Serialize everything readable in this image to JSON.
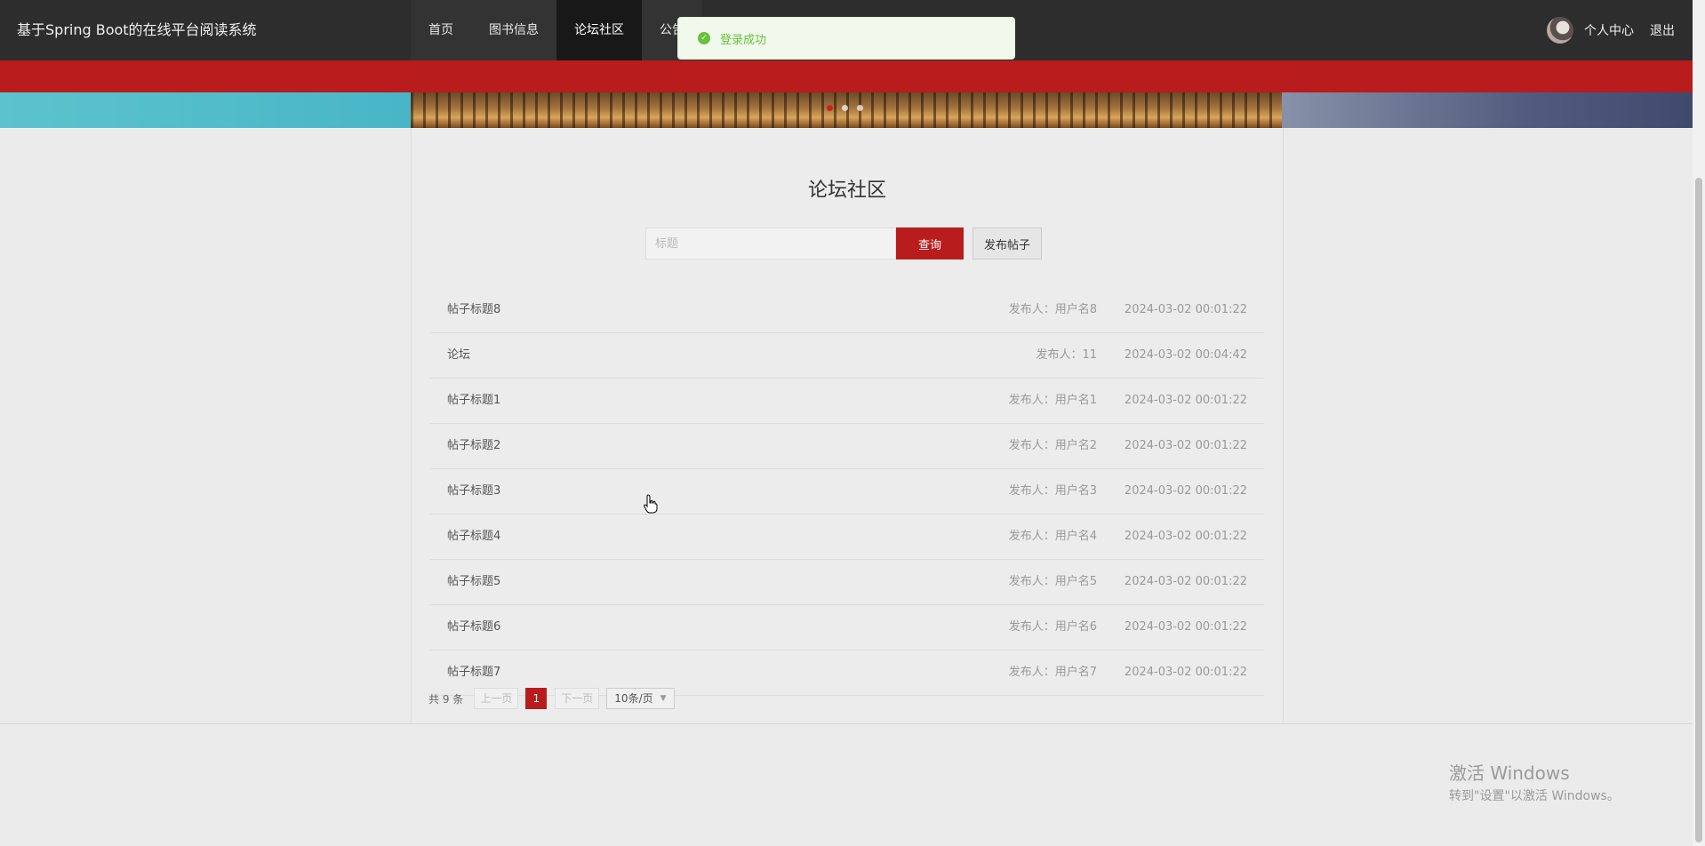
{
  "header": {
    "site_title": "基于Spring Boot的在线平台阅读系统",
    "nav": [
      "首页",
      "图书信息",
      "论坛社区",
      "公告"
    ],
    "active_nav": 2,
    "user_center": "个人中心",
    "logout": "退出"
  },
  "toast": {
    "message": "登录成功",
    "icon": "check-circle-icon",
    "color": "#67c23a"
  },
  "forum": {
    "title": "论坛社区",
    "search_placeholder": "标题",
    "search_button": "查询",
    "post_button": "发布帖子",
    "posts": [
      {
        "title": "帖子标题8",
        "author": "发布人：用户名8",
        "time": "2024-03-02 00:01:22"
      },
      {
        "title": "论坛",
        "author": "发布人：11",
        "time": "2024-03-02 00:04:42"
      },
      {
        "title": "帖子标题1",
        "author": "发布人：用户名1",
        "time": "2024-03-02 00:01:22"
      },
      {
        "title": "帖子标题2",
        "author": "发布人：用户名2",
        "time": "2024-03-02 00:01:22"
      },
      {
        "title": "帖子标题3",
        "author": "发布人：用户名3",
        "time": "2024-03-02 00:01:22"
      },
      {
        "title": "帖子标题4",
        "author": "发布人：用户名4",
        "time": "2024-03-02 00:01:22"
      },
      {
        "title": "帖子标题5",
        "author": "发布人：用户名5",
        "time": "2024-03-02 00:01:22"
      },
      {
        "title": "帖子标题6",
        "author": "发布人：用户名6",
        "time": "2024-03-02 00:01:22"
      },
      {
        "title": "帖子标题7",
        "author": "发布人：用户名7",
        "time": "2024-03-02 00:01:22"
      }
    ]
  },
  "pagination": {
    "total": "共 9 条",
    "prev": "上一页",
    "current": "1",
    "next": "下一页",
    "page_size": "10条/页"
  },
  "watermark": {
    "line1": "激活 Windows",
    "line2": "转到\"设置\"以激活 Windows。"
  },
  "colors": {
    "brand_red": "#b81c1c",
    "nav_bg": "#2d2d2d"
  }
}
